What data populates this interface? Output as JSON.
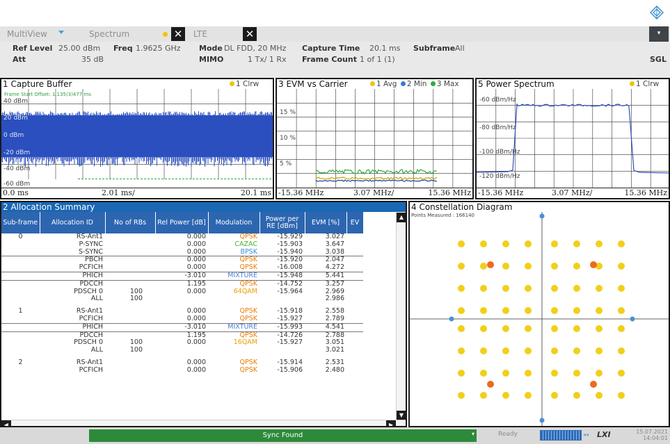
{
  "tabs": [
    {
      "label": "MultiView"
    },
    {
      "label": "Spectrum"
    },
    {
      "label": "LTE"
    }
  ],
  "sgl_label": "SGL",
  "params": {
    "ref_level_label": "Ref Level",
    "ref_level": "25.00 dBm",
    "freq_label": "Freq",
    "freq": "1.9625 GHz",
    "mode_label": "Mode",
    "mode": "DL FDD, 20 MHz",
    "capture_time_label": "Capture Time",
    "capture_time": "20.1 ms",
    "subframe_label": "Subframe",
    "subframe": "All",
    "att_label": "Att",
    "att": "35 dB",
    "mimo_label": "MIMO",
    "mimo": "1 Tx/ 1 Rx",
    "frame_count_label": "Frame Count",
    "frame_count": "1 of 1 (1)"
  },
  "capture_buffer": {
    "title": "1 Capture Buffer",
    "legend": "1 Clrw",
    "annotation": "Frame Start Offset: 1.135(3)477 ms",
    "y_labels": [
      "40 dBm",
      "20 dBm",
      "0 dBm",
      "-20 dBm",
      "-40 dBm",
      "-60 dBm"
    ],
    "x_start": "0.0 ms",
    "x_step": "2.01 ms/",
    "x_end": "20.1 ms"
  },
  "evm_carrier": {
    "title": "3 EVM vs Carrier",
    "legend": [
      "1 Avg",
      "2 Min",
      "3 Max"
    ],
    "legend_colors": [
      "#f1c40f",
      "#3a7bd5",
      "#2eaa3a"
    ],
    "y_labels": [
      "15 %",
      "10 %",
      "5 %"
    ],
    "x_start": "-15.36 MHz",
    "x_step": "3.07 MHz/",
    "x_end": "15.36 MHz"
  },
  "power_spectrum": {
    "title": "5 Power Spectrum",
    "legend": "1 Clrw",
    "y_labels": [
      "-60 dBm/Hz",
      "-80 dBm/Hz",
      "-100 dBm/Hz",
      "-120 dBm/Hz"
    ],
    "x_start": "-15.36 MHz",
    "x_step": "3.07 MHz/",
    "x_end": "15.36 MHz"
  },
  "allocation": {
    "title": "2 Allocation Summary",
    "headers": [
      "Sub-frame",
      "Allocation ID",
      "No of RBs",
      "Rel Power [dB]",
      "Modulation",
      "Power per RE [dBm]",
      "EVM [%]",
      "EV"
    ],
    "rows": [
      {
        "sf": "0",
        "id": "RS-Ant1",
        "rbs": "",
        "rel": "0.000",
        "mod": "QPSK",
        "mc": "m-qpsk",
        "pwr": "-15.929",
        "evm": "3.027"
      },
      {
        "sf": "",
        "id": "P-SYNC",
        "rbs": "",
        "rel": "0.000",
        "mod": "CAZAC",
        "mc": "m-cazac",
        "pwr": "-15.903",
        "evm": "3.647"
      },
      {
        "sf": "",
        "id": "S-SYNC",
        "rbs": "",
        "rel": "0.000",
        "mod": "BPSK",
        "mc": "m-bpsk",
        "pwr": "-15.940",
        "evm": "3.038"
      },
      {
        "sf": "",
        "id": "PBCH",
        "rbs": "",
        "rel": "0.000",
        "mod": "QPSK",
        "mc": "m-qpsk",
        "pwr": "-15.920",
        "evm": "2.047"
      },
      {
        "sf": "",
        "id": "PCFICH",
        "rbs": "",
        "rel": "0.000",
        "mod": "QPSK",
        "mc": "m-qpsk",
        "pwr": "-16.008",
        "evm": "4.272"
      },
      {
        "sf": "",
        "id": "PHICH",
        "rbs": "",
        "rel": "-3.010",
        "mod": "MIXTURE",
        "mc": "m-mix",
        "pwr": "-15.948",
        "evm": "5.441"
      },
      {
        "sf": "",
        "id": "PDCCH",
        "rbs": "",
        "rel": "1.195",
        "mod": "QPSK",
        "mc": "m-qpsk",
        "pwr": "-14.752",
        "evm": "3.257"
      },
      {
        "sf": "",
        "id": "PDSCH 0",
        "rbs": "100",
        "rel": "0.000",
        "mod": "64QAM",
        "mc": "m-64",
        "pwr": "-15.964",
        "evm": "2.969"
      },
      {
        "sf": "",
        "id": "ALL",
        "rbs": "100",
        "rel": "",
        "mod": "",
        "mc": "",
        "pwr": "",
        "evm": "2.986"
      },
      {
        "sf": "1",
        "id": "RS-Ant1",
        "rbs": "",
        "rel": "0.000",
        "mod": "QPSK",
        "mc": "m-qpsk",
        "pwr": "-15.918",
        "evm": "2.558"
      },
      {
        "sf": "",
        "id": "PCFICH",
        "rbs": "",
        "rel": "0.000",
        "mod": "QPSK",
        "mc": "m-qpsk",
        "pwr": "-15.927",
        "evm": "2.789"
      },
      {
        "sf": "",
        "id": "PHICH",
        "rbs": "",
        "rel": "-3.010",
        "mod": "MIXTURE",
        "mc": "m-mix",
        "pwr": "-15.993",
        "evm": "4.541"
      },
      {
        "sf": "",
        "id": "PDCCH",
        "rbs": "",
        "rel": "1.195",
        "mod": "QPSK",
        "mc": "m-qpsk",
        "pwr": "-14.726",
        "evm": "2.788"
      },
      {
        "sf": "",
        "id": "PDSCH 0",
        "rbs": "100",
        "rel": "0.000",
        "mod": "16QAM",
        "mc": "m-64",
        "pwr": "-15.927",
        "evm": "3.051"
      },
      {
        "sf": "",
        "id": "ALL",
        "rbs": "100",
        "rel": "",
        "mod": "",
        "mc": "",
        "pwr": "",
        "evm": "3.021"
      },
      {
        "sf": "2",
        "id": "RS-Ant1",
        "rbs": "",
        "rel": "0.000",
        "mod": "QPSK",
        "mc": "m-qpsk",
        "pwr": "-15.914",
        "evm": "2.531"
      },
      {
        "sf": "",
        "id": "PCFICH",
        "rbs": "",
        "rel": "0.000",
        "mod": "QPSK",
        "mc": "m-qpsk",
        "pwr": "-15.906",
        "evm": "2.480"
      }
    ]
  },
  "constellation": {
    "title": "4 Constellation Diagram",
    "points_measured": "Points Measured : 166140"
  },
  "status": {
    "sync": "Sync Found",
    "ready": "Ready",
    "date": "15.07.2021",
    "time": "14:04:01"
  }
}
